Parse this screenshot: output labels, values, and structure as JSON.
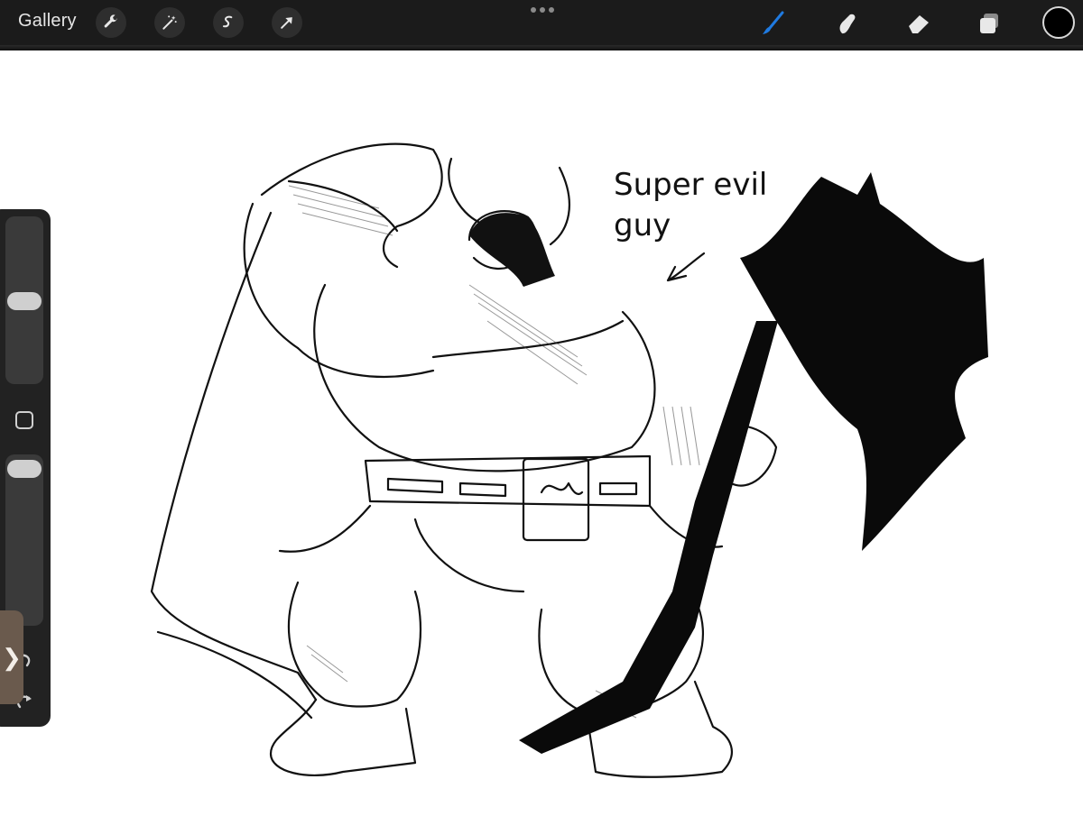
{
  "toolbar": {
    "gallery_label": "Gallery",
    "left_tools": [
      "wrench-icon",
      "magic-wand-icon",
      "selection-icon",
      "transform-arrow-icon"
    ],
    "right_tools": [
      "brush-icon",
      "smudge-icon",
      "eraser-icon",
      "layers-icon"
    ],
    "active_tool": "brush-icon",
    "current_color": "#000000",
    "accent_color": "#1f7ae0"
  },
  "sidebar": {
    "brush_size_level": 0.55,
    "opacity_level": 0.05
  },
  "canvas": {
    "annotation_line1": "Super evil",
    "annotation_line2": "guy"
  }
}
